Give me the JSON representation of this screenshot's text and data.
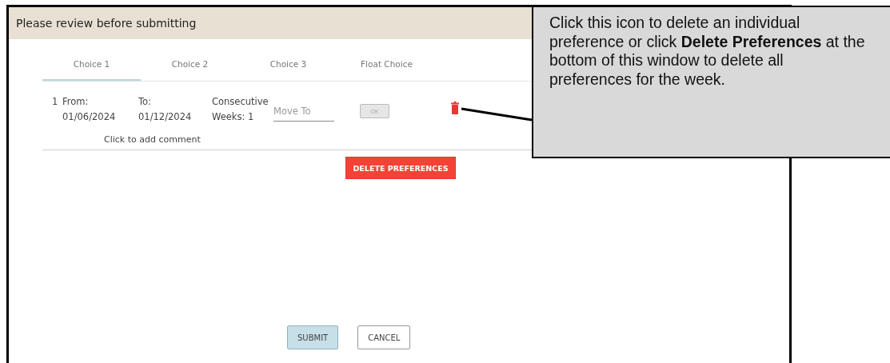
{
  "dialog": {
    "title": "Please review before submitting",
    "tabs": [
      {
        "label": "Choice 1",
        "selected": true
      },
      {
        "label": "Choice 2",
        "selected": false
      },
      {
        "label": "Choice 3",
        "selected": false
      },
      {
        "label": "Float Choice",
        "selected": false
      }
    ],
    "preferences": [
      {
        "number": "1",
        "from_label": "From:",
        "from_date": "01/06/2024",
        "to_label": "To:",
        "to_date": "01/12/2024",
        "consecutive": "Consecutive Weeks: 1",
        "move_to": {
          "placeholder": "Move To"
        },
        "ok_button": {
          "label": "OK",
          "disabled": true
        },
        "comment_link": "Click to add comment"
      }
    ],
    "delete_button": "DELETE PREFERENCES",
    "buttons": [
      {
        "label": "SUBMIT",
        "kind": "primary"
      },
      {
        "label": "CANCEL",
        "kind": "secondary"
      }
    ]
  },
  "callout": {
    "text": "Click this icon to delete an individual preference or click **Delete Preferences** at the bottom of this window to delete all preferences for the week."
  }
}
